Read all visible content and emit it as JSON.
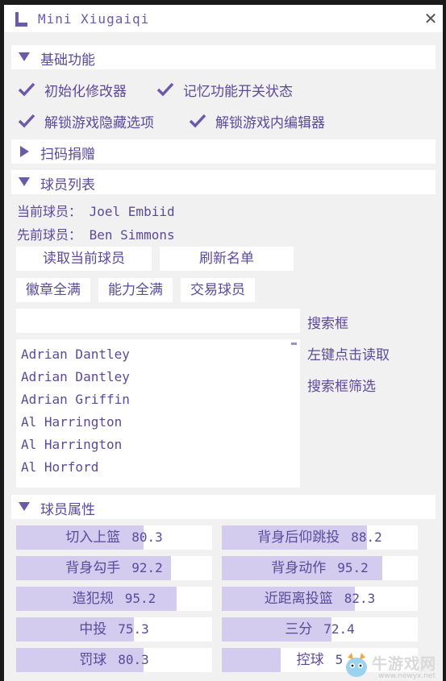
{
  "window": {
    "title": "Mini Xiugaiqi",
    "close_glyph": "✕"
  },
  "sections": {
    "basic": "基础功能",
    "donate": "扫码捐赠",
    "players": "球员列表",
    "attributes": "球员属性"
  },
  "basic": {
    "checkboxes": [
      {
        "label": "初始化修改器",
        "checked": true
      },
      {
        "label": "记忆功能开关状态",
        "checked": true
      },
      {
        "label": "解锁游戏隐藏选项",
        "checked": true
      },
      {
        "label": "解锁游戏内编辑器",
        "checked": true
      }
    ]
  },
  "players": {
    "current_line": "当前球员： Joel Embiid",
    "previous_line": "先前球员： Ben Simmons",
    "buttons": [
      "读取当前球员",
      "刷新名单",
      "徽章全满",
      "能力全满",
      "交易球员"
    ],
    "search_value": "",
    "side_labels": [
      "搜索框",
      "左键点击读取",
      "搜索框筛选"
    ],
    "list": [
      "Adrian Dantley",
      "Adrian Dantley",
      "Adrian Griffin",
      "Al Harrington",
      "Al Harrington",
      "Al Horford"
    ]
  },
  "attributes": {
    "items": [
      {
        "name": "切入上篮",
        "value": "80.3",
        "level": 0.65
      },
      {
        "name": "背身后仰跳投",
        "value": "88.2",
        "level": 0.74
      },
      {
        "name": "背身勾手",
        "value": "92.2",
        "level": 0.79
      },
      {
        "name": "背身动作",
        "value": "95.2",
        "level": 0.82
      },
      {
        "name": "造犯规",
        "value": "95.2",
        "level": 0.82
      },
      {
        "name": "近距离投篮",
        "value": "82.3",
        "level": 0.68
      },
      {
        "name": "中投",
        "value": "75.3",
        "level": 0.6
      },
      {
        "name": "三分",
        "value": "72.4",
        "level": 0.56
      },
      {
        "name": "罚球",
        "value": "80.3",
        "level": 0.65
      },
      {
        "name": "控球",
        "value": "5",
        "level": 0.3
      }
    ]
  },
  "watermark": {
    "brand": "牛游戏网",
    "url": "www.newyx.net"
  },
  "colors": {
    "accent": "#6a5aa8",
    "bar_fill": "#d3ccef",
    "panel_bg": "#f1f1f1"
  }
}
